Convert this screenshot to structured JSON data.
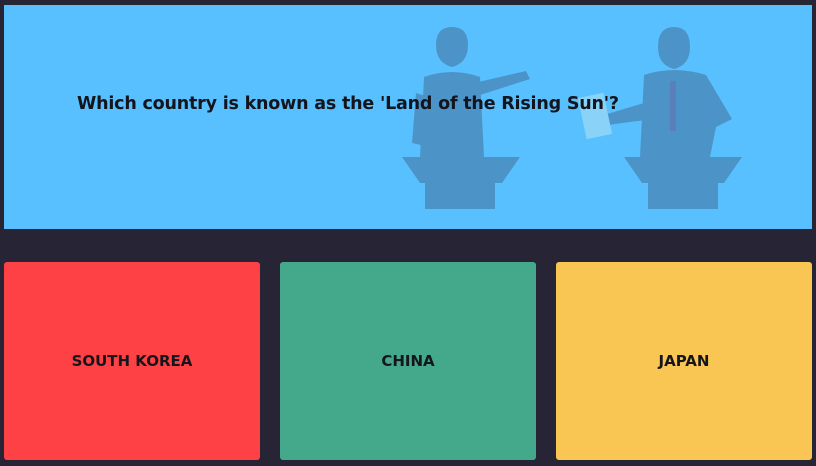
{
  "quiz": {
    "question": "Which country is known as the 'Land of the Rising Sun'?",
    "illustration_icon": "debate-speakers-illustration",
    "panel_color": "#58c0fe",
    "background_color": "#272435"
  },
  "answers": [
    {
      "label": "SOUTH KOREA",
      "color": "#fe4144"
    },
    {
      "label": "CHINA",
      "color": "#43a98a"
    },
    {
      "label": "JAPAN",
      "color": "#f9c553"
    }
  ]
}
